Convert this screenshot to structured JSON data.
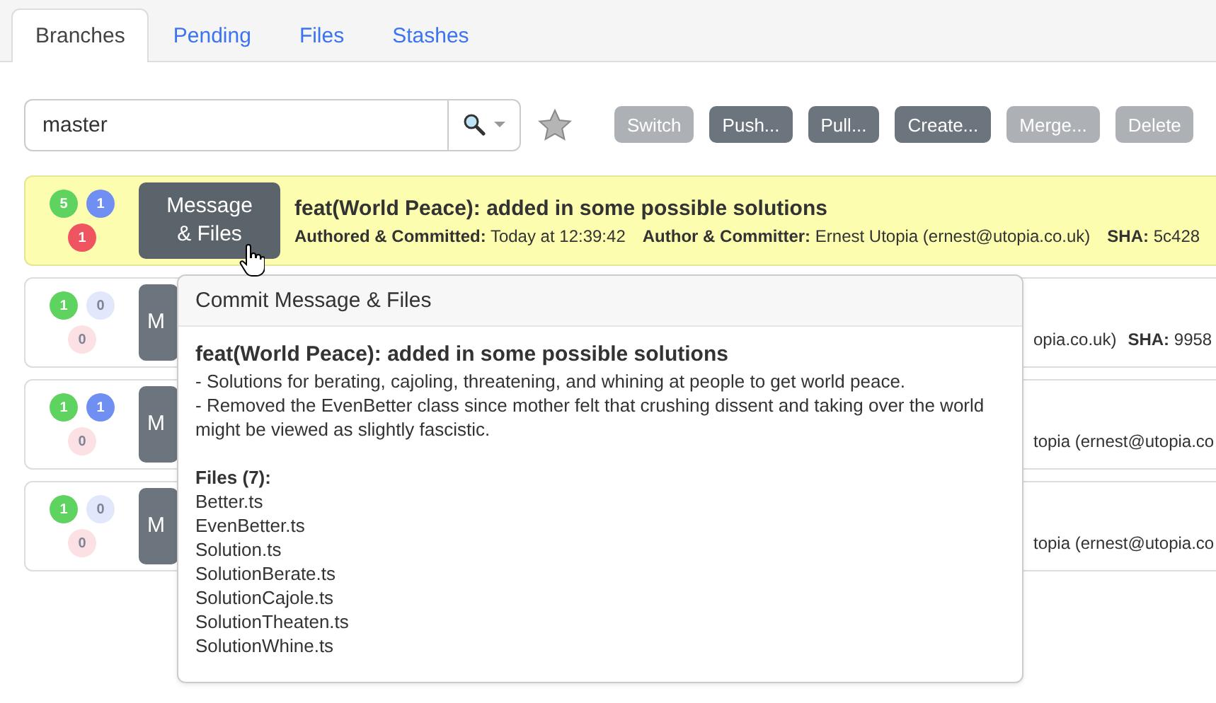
{
  "tabs": [
    {
      "label": "Branches",
      "selected": true
    },
    {
      "label": "Pending",
      "selected": false
    },
    {
      "label": "Files",
      "selected": false
    },
    {
      "label": "Stashes",
      "selected": false
    }
  ],
  "search": {
    "value": "master"
  },
  "buttons": [
    {
      "label": "Switch",
      "disabled": true
    },
    {
      "label": "Push...",
      "disabled": false
    },
    {
      "label": "Pull...",
      "disabled": false
    },
    {
      "label": "Create...",
      "disabled": false
    },
    {
      "label": "Merge...",
      "disabled": true
    },
    {
      "label": "Delete",
      "disabled": true
    }
  ],
  "commits": [
    {
      "kind": "full",
      "selected": true,
      "badges": [
        {
          "value": "5",
          "color": "#5fd35f"
        },
        {
          "value": "1",
          "color": "#6f8ff2"
        },
        {
          "value": "1",
          "color": "#ef5560"
        }
      ],
      "button_lines": [
        "Message",
        "& Files"
      ],
      "title": "feat(World Peace): added in some possible solutions",
      "meta": [
        {
          "label": "Authored & Committed:",
          "value": "Today at 12:39:42"
        },
        {
          "label": "Author & Committer:",
          "value": "Ernest Utopia (ernest@utopia.co.uk)"
        },
        {
          "label": "SHA:",
          "value": "5c428"
        }
      ]
    },
    {
      "kind": "covered",
      "selected": false,
      "badges": [
        {
          "value": "1",
          "color": "#5fd35f",
          "faded": false
        },
        {
          "value": "0",
          "color": "#e2e8fb",
          "faded": true
        },
        {
          "value": "0",
          "color": "#fbe1e3",
          "faded": true
        }
      ],
      "button_lines": [
        "M"
      ],
      "meta": [
        {
          "value": "opia.co.uk)"
        },
        {
          "label": "SHA:",
          "value": "9958"
        }
      ]
    },
    {
      "kind": "covered",
      "selected": false,
      "badges": [
        {
          "value": "1",
          "color": "#5fd35f",
          "faded": false
        },
        {
          "value": "1",
          "color": "#6f8ff2",
          "faded": false
        },
        {
          "value": "0",
          "color": "#fbe1e3",
          "faded": true
        }
      ],
      "button_lines": [
        "M"
      ],
      "meta": [
        {
          "value": "topia (ernest@utopia.co"
        }
      ]
    },
    {
      "kind": "covered",
      "selected": false,
      "badges": [
        {
          "value": "1",
          "color": "#5fd35f",
          "faded": false
        },
        {
          "value": "0",
          "color": "#e2e8fb",
          "faded": true
        },
        {
          "value": "0",
          "color": "#fbe1e3",
          "faded": true
        }
      ],
      "button_lines": [
        "M"
      ],
      "meta": [
        {
          "value": "topia (ernest@utopia.co"
        }
      ]
    }
  ],
  "popover": {
    "title": "Commit Message & Files",
    "subject": "feat(World Peace): added in some possible solutions",
    "body": [
      "- Solutions for berating, cajoling, threatening, and whining at people to get world peace.",
      "- Removed the EvenBetter class since mother felt that crushing dissent and taking over the world might be viewed as slightly fascistic."
    ],
    "files_heading": "Files (7):",
    "files": [
      "Better.ts",
      "EvenBetter.ts",
      "Solution.ts",
      "SolutionBerate.ts",
      "SolutionCajole.ts",
      "SolutionTheaten.ts",
      "SolutionWhine.ts"
    ]
  }
}
